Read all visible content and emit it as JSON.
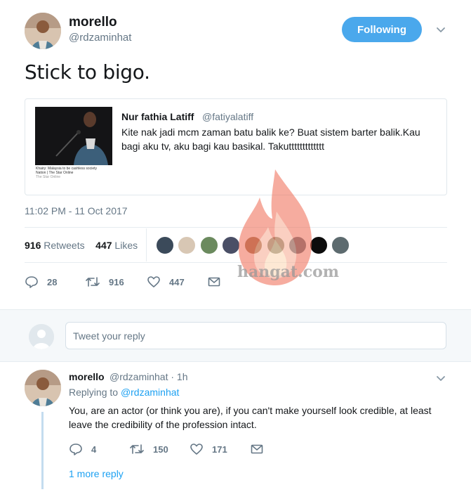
{
  "tweet": {
    "author_name": "morello",
    "author_handle": "@rdzaminhat",
    "follow_label": "Following",
    "text": "Stick to bigo.",
    "timestamp": "11:02 PM - 11 Oct 2017",
    "retweets_count": "916",
    "retweets_label": "Retweets",
    "likes_count": "447",
    "likes_label": "Likes",
    "actions": {
      "reply_count": "28",
      "retweet_count": "916",
      "like_count": "447"
    }
  },
  "quote": {
    "name": "Nur fathia Latiff",
    "handle": "@fatiyalatiff",
    "text": "Kite nak jadi mcm zaman batu balik ke? Buat sistem barter balik.Kau bagi aku tv, aku bagi kau basikal. Takuttttttttttttt",
    "media_caption_line1": "Khairy: Malaysia to be cashless society",
    "media_caption_line2": "Nation | The Star Online",
    "media_caption_line3": "The Star Online"
  },
  "watermark": {
    "text": "hangat.com"
  },
  "reply_box": {
    "placeholder": "Tweet your reply"
  },
  "reply": {
    "author_name": "morello",
    "meta": "@rdzaminhat · 1h",
    "replying_prefix": "Replying to",
    "replying_handle": "@rdzaminhat",
    "text": "You, are an actor (or think you are), if you can't make yourself look credible, at least leave the credibility of the profession intact.",
    "reply_count": "4",
    "retweet_count": "150",
    "like_count": "171",
    "more_replies": "1 more reply"
  },
  "colors": {
    "accent": "#1da1f2",
    "follow_button": "#4aa8ec",
    "muted": "#657786"
  },
  "icons": [
    "chevron-down-icon",
    "reply-icon",
    "retweet-icon",
    "heart-icon",
    "mail-icon"
  ]
}
